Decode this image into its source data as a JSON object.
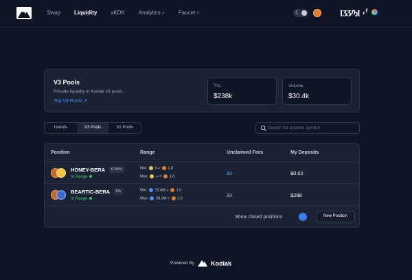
{
  "nav": {
    "items": [
      {
        "label": "Swap",
        "active": false,
        "external": false
      },
      {
        "label": "Liquidity",
        "active": true,
        "external": false
      },
      {
        "label": "xKDK",
        "active": false,
        "external": false
      },
      {
        "label": "Analytics",
        "active": false,
        "external": true
      },
      {
        "label": "Faucet",
        "active": false,
        "external": true
      }
    ],
    "external_glyph": "↗"
  },
  "header": {
    "wallet_text": "ꞁӡӡԡꞁ ᵣᶠ",
    "theme_icon": "moon-icon",
    "token_icon": "bera-token-icon"
  },
  "v3": {
    "title": "V3 Pools",
    "subtitle": "Provide liquidity in Kodiak v3 pools",
    "link": "Top V3 Pools ↗",
    "tvl_label": "TVL",
    "tvl_value": "$238k",
    "volume_label": "Volume",
    "volume_value": "$30.4k"
  },
  "tabs": [
    {
      "label": "Islands",
      "active": false
    },
    {
      "label": "V3 Pools",
      "active": true
    },
    {
      "label": "V2 Pools",
      "active": false
    }
  ],
  "search": {
    "placeholder": "Search for a token symbol"
  },
  "table": {
    "headers": {
      "position": "Position",
      "range": "Range",
      "fees": "Unclaimed Fees",
      "deposits": "My Deposits"
    },
    "rows": [
      {
        "pair": "HONEY-BERA",
        "fee": "0.05%",
        "status": "In Range",
        "min_label": "Min:",
        "min_value": "0 =",
        "min_rate": "1.0",
        "max_label": "Max:",
        "max_value": "∞ =",
        "max_rate": "1.0",
        "fees": "$0",
        "deposit": "$0.02"
      },
      {
        "pair": "BEARTIC-BERA",
        "fee": "1%",
        "status": "In Range",
        "min_label": "Min:",
        "min_value": "15.5M =",
        "min_rate": "1.0",
        "max_label": "Max:",
        "max_value": "20.2M =",
        "max_rate": "1.0",
        "fees": "$0",
        "deposit": "$288"
      }
    ],
    "show_closed": "Show closed positions",
    "new_position": "New Position"
  },
  "footer": {
    "powered_by": "Powered By",
    "brand": "Kodiak"
  },
  "colors": {
    "background": "#0f1524",
    "card": "#1b2234",
    "accent_blue": "#4d8ff5",
    "in_range_green": "#39c46c"
  }
}
